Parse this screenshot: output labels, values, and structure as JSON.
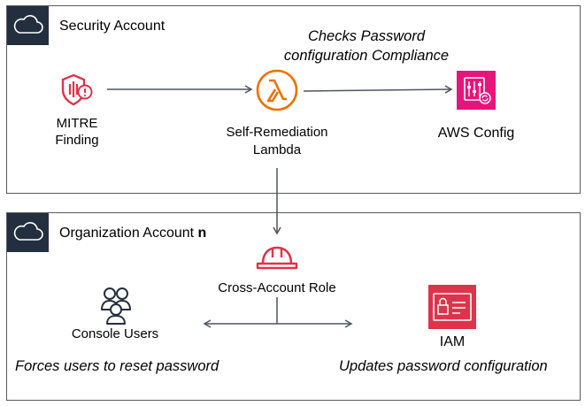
{
  "security_account": {
    "title": "Security Account"
  },
  "organization_account": {
    "title_prefix": "Organization Account ",
    "title_suffix": "n"
  },
  "nodes": {
    "mitre_finding": {
      "line1": "MITRE",
      "line2": "Finding"
    },
    "lambda": {
      "line1": "Self-Remediation",
      "line2": "Lambda"
    },
    "aws_config": {
      "label": "AWS Config"
    },
    "cross_account_role": {
      "label": "Cross-Account Role"
    },
    "console_users": {
      "label": "Console Users"
    },
    "iam": {
      "label": "IAM"
    }
  },
  "annotations": {
    "checks_compliance_line1": "Checks Password",
    "checks_compliance_line2": "configuration Compliance",
    "forces_reset": "Forces users to reset password",
    "updates_config": "Updates password configuration"
  },
  "colors": {
    "group_border": "#5a5a5a",
    "cloud_tab": "#232f3e",
    "security_red": "#dd344c",
    "lambda_orange": "#ed7100",
    "config_pink": "#e7157b",
    "arrow_gray": "#4d5561"
  }
}
